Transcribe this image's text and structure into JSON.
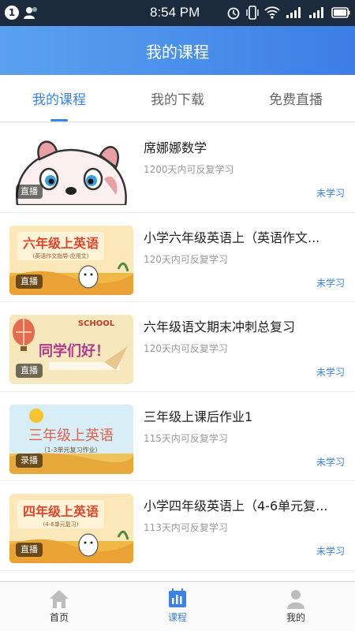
{
  "status_bar": {
    "notification_count": "1",
    "time": "8:54 PM"
  },
  "header": {
    "title": "我的课程"
  },
  "tabs": [
    {
      "label": "我的课程",
      "active": true
    },
    {
      "label": "我的下载",
      "active": false
    },
    {
      "label": "免费直播",
      "active": false
    }
  ],
  "courses": [
    {
      "title": "席娜娜数学",
      "subtitle": "1200天内可反复学习",
      "tag": "直播",
      "status": "未学习",
      "thumb_text": ""
    },
    {
      "title": "小学六年级英语上（英语作文...",
      "subtitle": "120天内可反复学习",
      "tag": "直播",
      "status": "未学习",
      "thumb_text": "六年级上英语",
      "thumb_subtext": "(英语作文指导-应用文)"
    },
    {
      "title": "六年级语文期末冲刺总复习",
      "subtitle": "120天内可反复学习",
      "tag": "直播",
      "status": "未学习",
      "thumb_text": "同学们好！",
      "thumb_subtext": "SCHOOL"
    },
    {
      "title": "三年级上课后作业1",
      "subtitle": "115天内可反复学习",
      "tag": "录播",
      "status": "未学习",
      "thumb_text": "三年级上英语",
      "thumb_subtext": "（1-3单元复习作业）"
    },
    {
      "title": "小学四年级英语上（4-6单元复...",
      "subtitle": "113天内可反复学习",
      "tag": "直播",
      "status": "未学习",
      "thumb_text": "四年级上英语",
      "thumb_subtext": "(4-6单元复习)"
    }
  ],
  "bottom_nav": [
    {
      "label": "首页",
      "icon": "home-icon",
      "active": false
    },
    {
      "label": "课程",
      "icon": "course-chart-icon",
      "active": true
    },
    {
      "label": "我的",
      "icon": "user-icon",
      "active": false
    }
  ],
  "colors": {
    "accent": "#3a82e4",
    "status_bar": "#1c2a3e"
  }
}
